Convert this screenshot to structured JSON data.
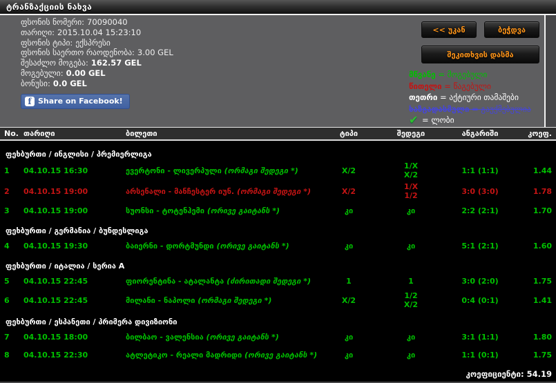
{
  "title": "ტრანზაქციის ნახვა",
  "colors": {
    "won": "#00c000",
    "lost": "#c41414",
    "active": "#ffffff",
    "void": "#4646d8",
    "button_text": "#ff9418",
    "facebook_blue": "#4061a2",
    "page_bg": "#5e5e60",
    "table_bg": "#000000"
  },
  "info": {
    "bet_number_label": "ფსონის ნომერი:",
    "bet_number": "70090040",
    "date_label": "თარიღი:",
    "date": "2015.10.04 15:23:10",
    "bet_type_label": "ფსონის ტიპი:",
    "bet_type": "ექსპრესი",
    "total_label": "ფსონის საერთო რაოდენობა:",
    "total": "3.00 GEL",
    "possible_win_label": "შესაძლო მოგება:",
    "possible_win": "162.57 GEL",
    "won_label": "მოგებული:",
    "won": "0.00 GEL",
    "bonus_label": "ბონუსი:",
    "bonus": "0.0 GEL",
    "facebook_share": "Share on Facebook!",
    "facebook_f": "f"
  },
  "toolbar": {
    "back": "<< უკან",
    "print": "ბეჭდვა",
    "ask": "შეკითხვის დასმა"
  },
  "legend": {
    "items": [
      {
        "term": "მწვანე",
        "desc": " = მოგებული"
      },
      {
        "term": "წითელი",
        "desc": " = წაგებული"
      },
      {
        "term": "თეთრი",
        "desc": " = აქტიური თამაშები"
      },
      {
        "term": "ხაზგადასმული",
        "desc": " = გაუქმებულია"
      },
      {
        "term": "✔",
        "desc": " = ლობი"
      }
    ]
  },
  "table": {
    "headers": {
      "no": "No.",
      "date": "თარიღი",
      "ticket": "ბილეთი",
      "type": "ტიპი",
      "result": "შედეგი",
      "score": "ანგარიში",
      "coef": "კოეფ."
    },
    "groups": [
      {
        "section": "ფეხბურთი / ინგლისი / პრემიერლიგა",
        "rows": [
          {
            "no": "1",
            "date": "04.10.15 16:30",
            "match": "ევერტონი - ლივერპული",
            "market": "(ორმაგი შედეგი *)",
            "type": "X/2",
            "result1": "1/X",
            "result2": "X/2",
            "score": "1:1 (1:1)",
            "coef": "1.44",
            "status": "won"
          },
          {
            "no": "2",
            "date": "04.10.15 19:00",
            "match": "არსენალი - მანჩესტერ იუნ.",
            "market": "(ორმაგი შედეგი *)",
            "type": "X/2",
            "result1": "1/X",
            "result2": "1/2",
            "score": "3:0 (3:0)",
            "coef": "1.78",
            "status": "lost"
          },
          {
            "no": "3",
            "date": "04.10.15 19:00",
            "match": "სუონსი - ტოტენჰემი",
            "market": "(ორივე გაიტანს *)",
            "type": "კი",
            "result1": "კი",
            "result2": "",
            "score": "2:2 (2:1)",
            "coef": "1.70",
            "status": "won"
          }
        ]
      },
      {
        "section": "ფეხბურთი / გერმანია / ბუნდესლიგა",
        "rows": [
          {
            "no": "4",
            "date": "04.10.15 19:30",
            "match": "ბაიერნი - დორტმუნდი",
            "market": "(ორივე გაიტანს *)",
            "type": "კი",
            "result1": "კი",
            "result2": "",
            "score": "5:1 (2:1)",
            "coef": "1.60",
            "status": "won"
          }
        ]
      },
      {
        "section": "ფეხბურთი / იტალია / სერია A",
        "rows": [
          {
            "no": "5",
            "date": "04.10.15 22:45",
            "match": "ფიორენტინა - ატალანტა",
            "market": "(ძირითადი შედეგი *)",
            "type": "1",
            "result1": "1",
            "result2": "",
            "score": "3:0 (2:0)",
            "coef": "1.75",
            "status": "won"
          },
          {
            "no": "6",
            "date": "04.10.15 22:45",
            "match": "მილანი - ნაპოლი",
            "market": "(ორმაგი შედეგი *)",
            "type": "X/2",
            "result1": "1/2",
            "result2": "X/2",
            "score": "0:4 (0:1)",
            "coef": "1.41",
            "status": "won"
          }
        ]
      },
      {
        "section": "ფეხბურთი / ესპანეთი / პრიმერა დივიზიონი",
        "rows": [
          {
            "no": "7",
            "date": "04.10.15 18:00",
            "match": "ბილბაო - ვალენსია",
            "market": "(ორივე გაიტანს *)",
            "type": "კი",
            "result1": "კი",
            "result2": "",
            "score": "3:1 (1:1)",
            "coef": "1.80",
            "status": "won"
          },
          {
            "no": "8",
            "date": "04.10.15 22:30",
            "match": "ატლეტიკო - რეალი მადრიდი",
            "market": "(ორივე გაიტანს *)",
            "type": "კი",
            "result1": "კი",
            "result2": "",
            "score": "1:1 (0:1)",
            "coef": "1.75",
            "status": "won"
          }
        ]
      }
    ],
    "footer_label": "კოეფიციენტი:",
    "footer_value": "54.19"
  }
}
